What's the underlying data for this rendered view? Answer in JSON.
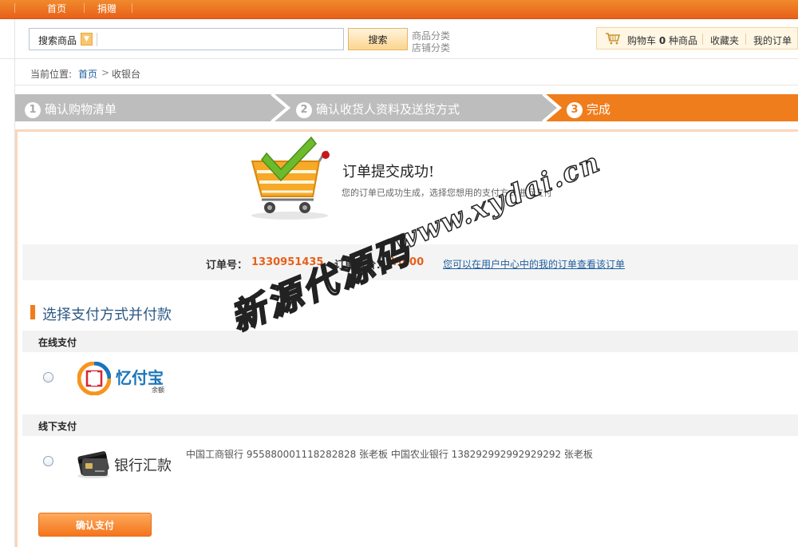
{
  "topnav": {
    "home": "首页",
    "donate": "捐赠"
  },
  "search": {
    "scope_label": "搜索商品",
    "placeholder": "",
    "button": "搜索",
    "category_goods": "商品分类",
    "category_shops": "店铺分类"
  },
  "user_bar": {
    "cart_prefix": "购物车",
    "cart_count": "0",
    "cart_suffix": "种商品",
    "favorites": "收藏夹",
    "my_orders": "我的订单"
  },
  "breadcrumb": {
    "prefix": "当前位置:",
    "home": "首页",
    "separator": ">",
    "current": "收银台"
  },
  "steps": [
    {
      "num": "1",
      "label": "确认购物清单"
    },
    {
      "num": "2",
      "label": "确认收货人资料及送货方式"
    },
    {
      "num": "3",
      "label": "完成"
    }
  ],
  "success": {
    "title": "订单提交成功!",
    "subtitle": "您的订单已成功生成，选择您想用的支付方式进行支付"
  },
  "order": {
    "number_label": "订单号：",
    "number": "1330951435",
    "total_label": "订单总价：",
    "total": "¥0.00",
    "link": "您可以在用户中心中的我的订单查看该订单"
  },
  "payment": {
    "section_title": "选择支付方式并付款",
    "online_label": "在线支付",
    "online_option_name": "忆付宝",
    "online_option_sub": "余额",
    "offline_label": "线下支付",
    "offline_option_name": "银行汇款",
    "bank_info": "中国工商银行 955880001118282828 张老板 中国农业银行 138292992992929292 张老板",
    "confirm_button": "确认支付"
  },
  "watermark": {
    "url_text": "www.xydai.cn",
    "brand_text": "新源代源码"
  },
  "colors": {
    "orange": "#f07d1c",
    "link_blue": "#1f5f9e",
    "order_orange": "#e8601a"
  }
}
